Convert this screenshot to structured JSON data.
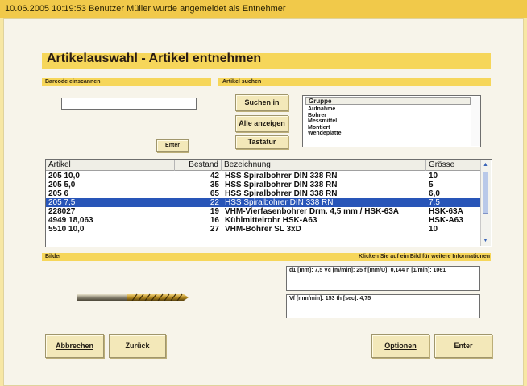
{
  "status_bar": {
    "text": "10.06.2005 10:19:53   Benutzer Müller wurde angemeldet als Entnehmer"
  },
  "page_title": "Artikelauswahl - Artikel entnehmen",
  "barcode": {
    "label": "Barcode einscannen",
    "value": "",
    "enter_label": "Enter"
  },
  "search": {
    "label": "Artikel suchen",
    "buttons": {
      "search_in": "Suchen in",
      "show_all": "Alle anzeigen",
      "keyboard": "Tastatur"
    },
    "group": {
      "header": "Gruppe",
      "items": [
        "Aufnahme",
        "Bohrer",
        "Messmittel",
        "Montiert",
        "Wendeplatte"
      ]
    }
  },
  "table": {
    "columns": [
      "Artikel",
      "Bestand",
      "Bezeichnung",
      "Grösse"
    ],
    "rows": [
      {
        "artikel": "205 10,0",
        "bestand": "42",
        "bezeichnung": "HSS Spiralbohrer DIN 338 RN",
        "groesse": "10",
        "selected": false
      },
      {
        "artikel": "205 5,0",
        "bestand": "35",
        "bezeichnung": "HSS Spiralbohrer DIN 338 RN",
        "groesse": "5",
        "selected": false
      },
      {
        "artikel": "205 6",
        "bestand": "65",
        "bezeichnung": "HSS Spiralbohrer DIN 338 RN",
        "groesse": "6,0",
        "selected": false
      },
      {
        "artikel": "205 7,5",
        "bestand": "22",
        "bezeichnung": "HSS Spiralbohrer DIN 338 RN",
        "groesse": "7,5",
        "selected": true
      },
      {
        "artikel": "228027",
        "bestand": "19",
        "bezeichnung": "VHM-Vierfasenbohrer Drm. 4,5 mm / HSK-63A",
        "groesse": "HSK-63A",
        "selected": false
      },
      {
        "artikel": "4949 18,063",
        "bestand": "16",
        "bezeichnung": "Kühlmittelrohr HSK-A63",
        "groesse": "HSK-A63",
        "selected": false
      },
      {
        "artikel": "5510 10,0",
        "bestand": "27",
        "bezeichnung": "VHM-Bohrer SL 3xD",
        "groesse": "10",
        "selected": false
      }
    ]
  },
  "images": {
    "label": "Bilder",
    "hint": "Klicken Sie auf ein Bild für weitere Informationen",
    "info1": "d1 [mm]: 7,5   Vc [m/min]: 25   f [mm/U]: 0,144   n [1/min]: 1061",
    "info2": "Vf [mm/min]: 153   th [sec]: 4,75"
  },
  "footer": {
    "cancel": "Abbrechen",
    "back": "Zurück",
    "options": "Optionen",
    "enter": "Enter"
  },
  "colors": {
    "accent": "#f6d65a",
    "selection": "#2855b8",
    "background": "#f7f4ea"
  }
}
